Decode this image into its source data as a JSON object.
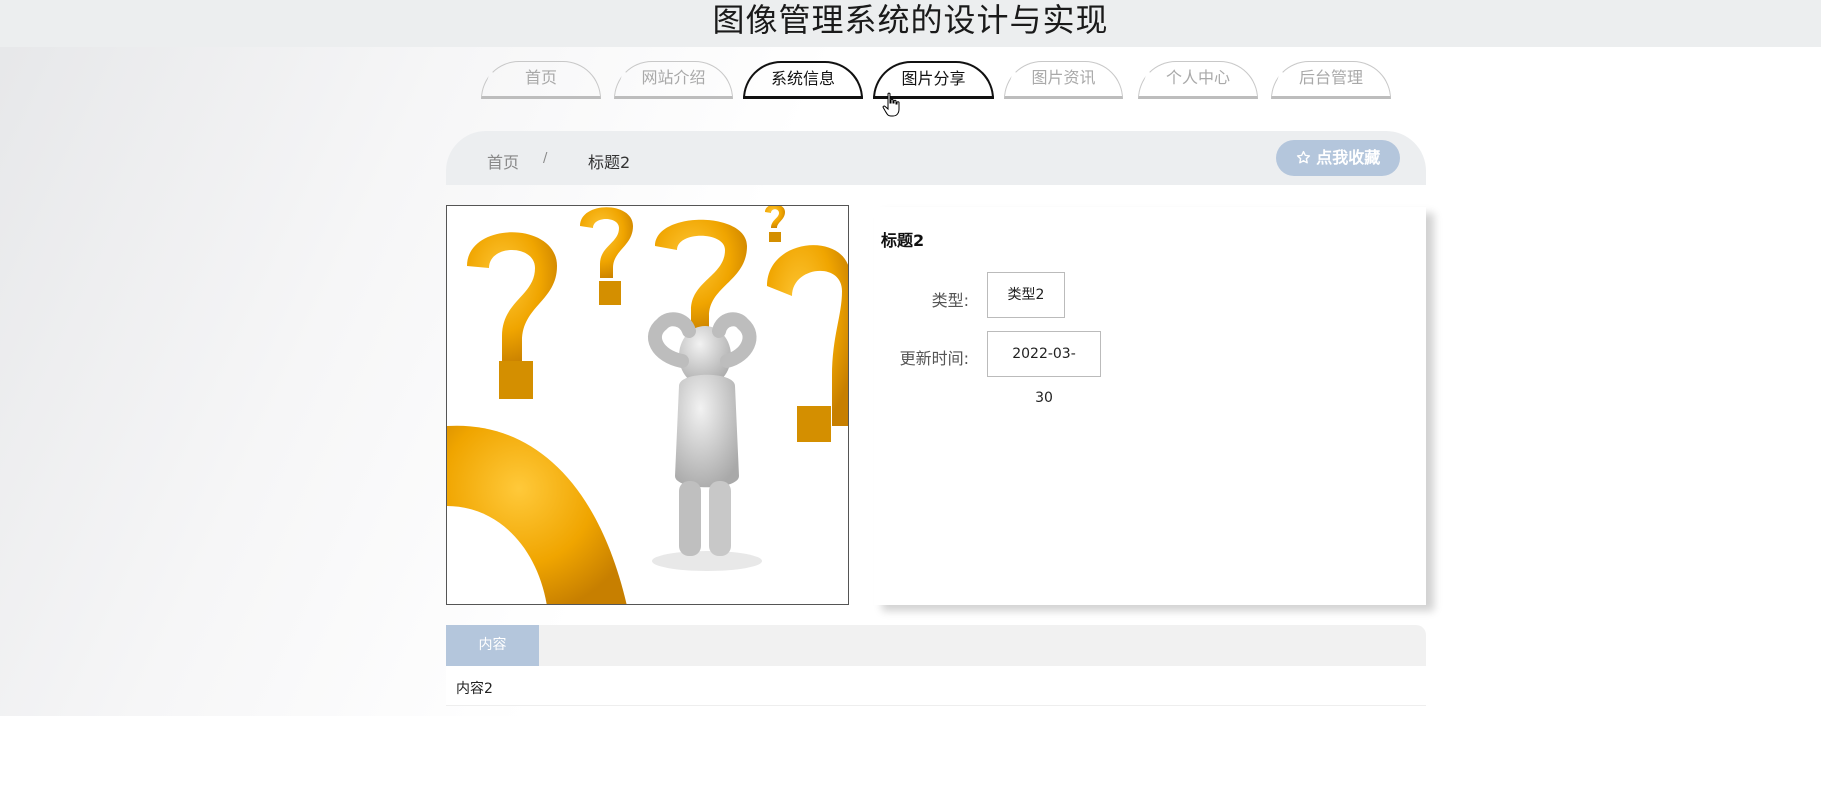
{
  "site": {
    "title": "图像管理系统的设计与实现"
  },
  "nav": {
    "items": [
      {
        "label": "首页"
      },
      {
        "label": "网站介绍"
      },
      {
        "label": "系统信息"
      },
      {
        "label": "图片分享"
      },
      {
        "label": "图片资讯"
      },
      {
        "label": "个人中心"
      },
      {
        "label": "后台管理"
      }
    ],
    "active": [
      "系统信息",
      "图片分享"
    ]
  },
  "breadcrumb": {
    "home": "首页",
    "separator": "/",
    "current": "标题2"
  },
  "favorite": {
    "icon": "star-outline-icon",
    "label": "点我收藏"
  },
  "detail": {
    "title": "标题2",
    "type_label": "类型:",
    "type_value": "类型2",
    "updated_label": "更新时间:",
    "updated_value": "2022-03-30"
  },
  "tabs": {
    "content_tab": "内容",
    "content_text": "内容2"
  },
  "colors": {
    "accent": "#b4c6dc",
    "header_bg": "#eceeef",
    "question_mark": "#f0a500"
  }
}
